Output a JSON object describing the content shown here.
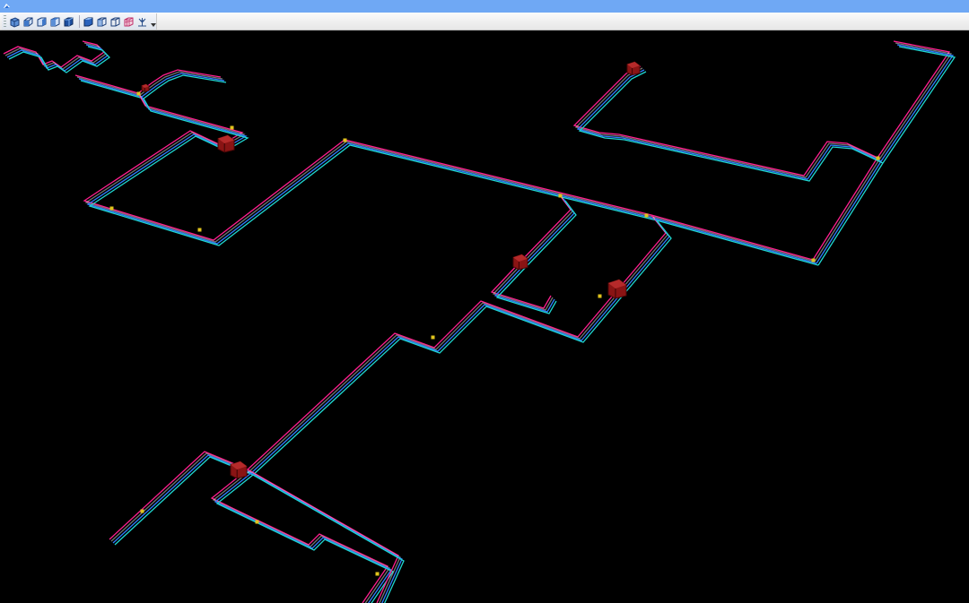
{
  "window": {
    "title": ""
  },
  "toolbar": {
    "buttons": [
      {
        "icon": "iso-view-icon"
      },
      {
        "icon": "top-view-icon"
      },
      {
        "icon": "front-view-icon"
      },
      {
        "icon": "side-view-icon"
      },
      {
        "icon": "solid-cube-icon"
      },
      {
        "icon": "shaded-cube-icon"
      },
      {
        "icon": "wire-cube-icon"
      },
      {
        "icon": "outline-cube-icon"
      },
      {
        "icon": "grid-cube-icon"
      },
      {
        "icon": "antenna-icon"
      }
    ]
  },
  "viewport": {
    "background": "#000000",
    "line_colors": {
      "magenta": "#ff1f8f",
      "cyan": "#1fd6d0",
      "blue": "#2e7dff",
      "white": "#e8e8e8"
    },
    "device_color": "#8a1414"
  }
}
